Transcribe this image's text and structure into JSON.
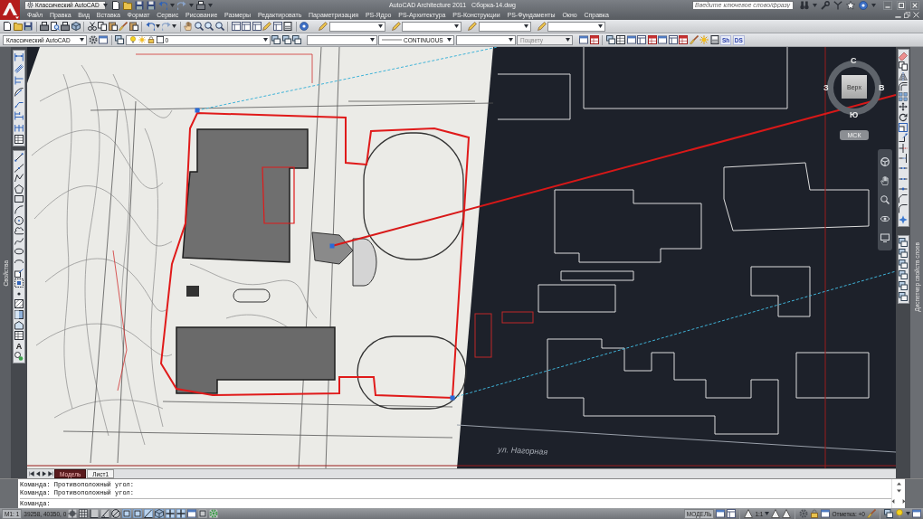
{
  "title_bar": {
    "workspace": "Классический AutoCAD",
    "title": "AutoCAD Architecture 2011",
    "file": "Сборка-14.dwg",
    "search": {
      "placeholder": "Введите ключевое слово/фразу"
    }
  },
  "menu": [
    "Файл",
    "Правка",
    "Вид",
    "Вставка",
    "Формат",
    "Сервис",
    "Рисование",
    "Размеры",
    "Редактировать",
    "Параметризация",
    "PS-Ядро",
    "PS-Архитектура",
    "PS-Конструкции",
    "PS-Фундаменты",
    "Окно",
    "Справка"
  ],
  "properties_toolbar": {
    "workspace": "Классический AutoCAD",
    "layer": "0",
    "linetype": "CONTINUOUS",
    "plot_style": {
      "value": "Поцвету",
      "disabled": true
    },
    "buttons": [
      "Sh",
      "DS"
    ]
  },
  "palettes": {
    "left": "Свойства",
    "right": "Диспетчер свойств слоев"
  },
  "draw_toolbar": {
    "text_tool": "A"
  },
  "drawing": {
    "street_label": "ул. Нагорная"
  },
  "viewcube": {
    "north": "С",
    "west": "З",
    "east": "В",
    "south": "Ю",
    "face": "Верх",
    "ucs": "МСК"
  },
  "layout_tabs": [
    {
      "label": "Модель",
      "selected": true
    },
    {
      "label": "Лист1",
      "selected": false
    }
  ],
  "command_history": [
    "Команда: Противоположный угол:",
    "Команда: Противоположный угол:"
  ],
  "command_prompt": "Команда:",
  "status_bar": {
    "scale": "M1: 1",
    "coordinates": "39258, 40350, 0",
    "space": "МОДЕЛЬ",
    "annotation_scale": "1:1",
    "elevation": "Отметка: +0"
  },
  "drawing_aids": [
    {
      "on": false
    },
    {
      "on": false
    },
    {
      "on": false
    },
    {
      "on": false
    },
    {
      "on": false
    },
    {
      "on": true
    },
    {
      "on": true
    },
    {
      "on": true
    },
    {
      "on": true
    },
    {
      "on": true
    },
    {
      "on": true
    },
    {
      "on": true
    },
    {
      "on": false
    },
    {
      "on": false
    }
  ]
}
